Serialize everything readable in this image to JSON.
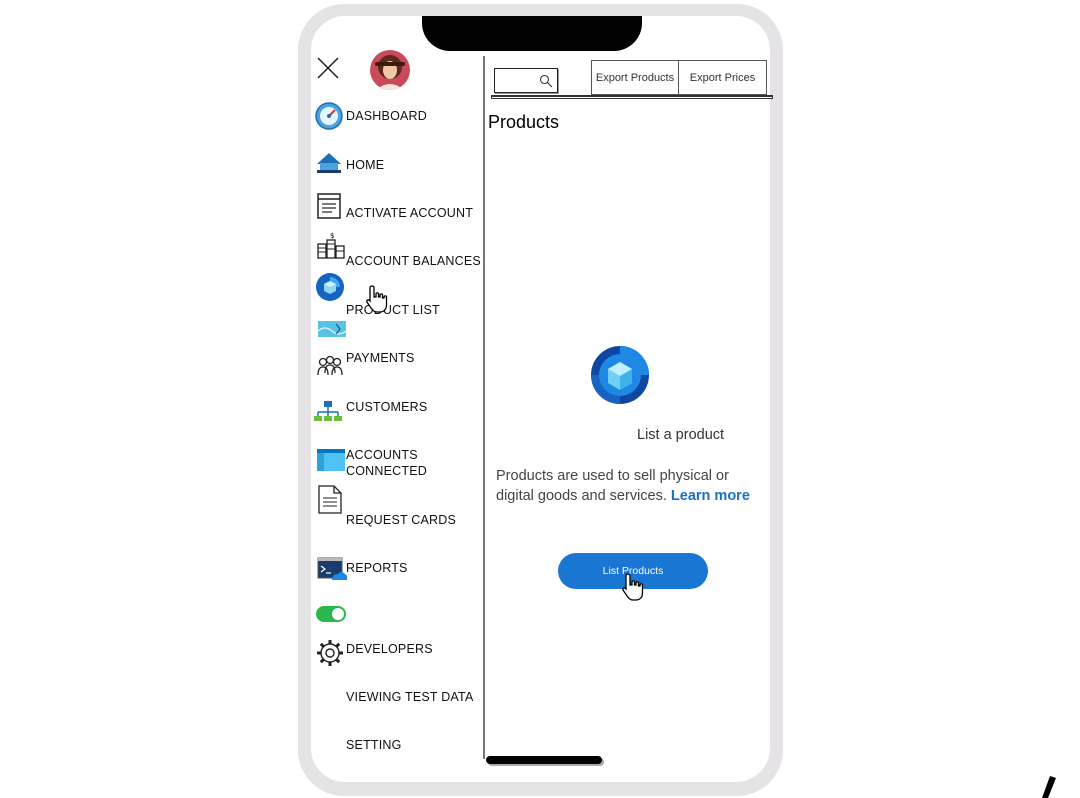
{
  "sidebar": {
    "items": [
      {
        "label": "DASHBOARD",
        "icon": "dashboard-icon"
      },
      {
        "label": "HOME",
        "icon": "home-icon"
      },
      {
        "label": "ACTIVATE ACCOUNT",
        "icon": "document-list-icon"
      },
      {
        "label": "ACCOUNT BALANCES",
        "icon": "coins-icon"
      },
      {
        "label": "PRODUCT LIST",
        "icon": "cube-icon"
      },
      {
        "label": "PAYMENTS",
        "icon": "people-icon"
      },
      {
        "label": "CUSTOMERS",
        "icon": "network-icon"
      },
      {
        "label": "ACCOUNTS",
        "label2": "CONNECTED",
        "icon": "window-icon"
      },
      {
        "label": "REQUEST CARDS",
        "icon": "page-icon"
      },
      {
        "label": "REPORTS",
        "icon": "terminal-cloud-icon"
      },
      {
        "label": "DEVELOPERS",
        "icon": "gear-icon"
      },
      {
        "label": "VIEWING TEST DATA"
      },
      {
        "label": "SETTING"
      }
    ]
  },
  "toolbar": {
    "export_products": "Export Products",
    "export_prices": "Export Prices"
  },
  "main": {
    "title": "Products",
    "empty_heading": "List a product",
    "description": "Products are used to sell physical or digital goods and services.",
    "learn_more": "Learn more",
    "cta_label": "List Products"
  },
  "colors": {
    "accent": "#1976d2",
    "link": "#1a6fc4",
    "toggle_on": "#2db84d"
  }
}
